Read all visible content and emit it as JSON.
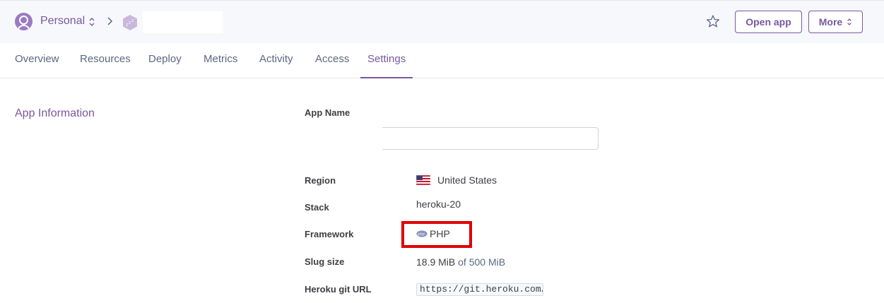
{
  "header": {
    "team_name": "Personal",
    "app_name": "",
    "open_app_label": "Open app",
    "more_label": "More"
  },
  "tabs": [
    {
      "label": "Overview"
    },
    {
      "label": "Resources"
    },
    {
      "label": "Deploy"
    },
    {
      "label": "Metrics"
    },
    {
      "label": "Activity"
    },
    {
      "label": "Access"
    },
    {
      "label": "Settings",
      "active": true
    }
  ],
  "app_info": {
    "section_title": "App Information",
    "app_name_label": "App Name",
    "app_name_value": "",
    "region_label": "Region",
    "region_value": "United States",
    "stack_label": "Stack",
    "stack_value": "heroku-20",
    "framework_label": "Framework",
    "framework_value": "PHP",
    "slug_label": "Slug size",
    "slug_value": "18.9 MiB",
    "slug_limit": "of 500 MiB",
    "git_label": "Heroku git URL",
    "git_value": "https://git.heroku.com/"
  },
  "icons": {
    "avatar": "user-avatar-icon",
    "team_switch": "up-down-chevron-icon",
    "breadcrumb": "chevron-right-icon",
    "app": "sleeping-app-icon",
    "favorite": "star-icon",
    "more_caret": "up-down-chevron-icon",
    "region": "us-flag-icon",
    "framework": "php-icon"
  },
  "colors": {
    "accent": "#79589f",
    "highlight_box": "#e00000",
    "muted_text": "#596981"
  }
}
